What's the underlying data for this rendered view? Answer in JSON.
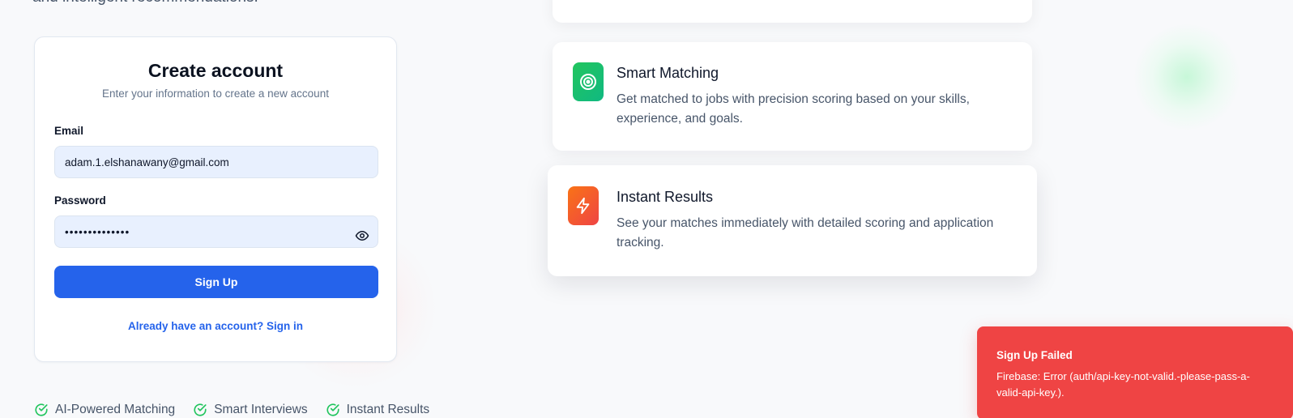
{
  "hero": {
    "tagline": "and intelligent recommendations."
  },
  "signup": {
    "title": "Create account",
    "subtitle": "Enter your information to create a new account",
    "email_label": "Email",
    "email_value": "adam.1.elshanawany@gmail.com",
    "password_label": "Password",
    "password_value": "••••••••••••••",
    "submit_label": "Sign Up",
    "signin_link": "Already have an account? Sign in"
  },
  "features": [
    {
      "title": "Smart Matching",
      "description": "Get matched to jobs with precision scoring based on your skills, experience, and goals.",
      "icon": "target-icon"
    },
    {
      "title": "Instant Results",
      "description": "See your matches immediately with detailed scoring and application tracking.",
      "icon": "lightning-icon"
    }
  ],
  "highlights": [
    "AI-Powered Matching",
    "Smart Interviews",
    "Instant Results"
  ],
  "toast": {
    "title": "Sign Up Failed",
    "message": "Firebase: Error (auth/api-key-not-valid.-please-pass-a-valid-api-key.)."
  },
  "colors": {
    "primary": "#2563eb",
    "error": "#ef4444",
    "success": "#22c55e",
    "warning": "#f97316"
  }
}
